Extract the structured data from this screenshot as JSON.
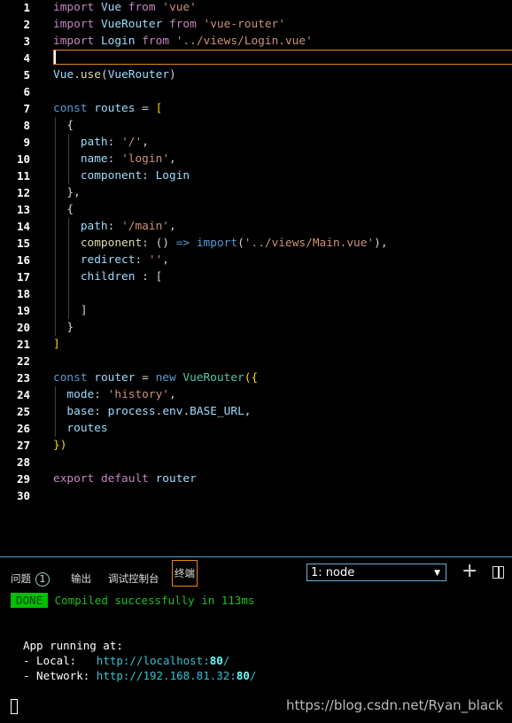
{
  "editor": {
    "lines": [
      [
        [
          "import ",
          "kw"
        ],
        [
          "Vue ",
          "v"
        ],
        [
          "from ",
          "kw"
        ],
        [
          "'vue'",
          "s"
        ]
      ],
      [
        [
          "import ",
          "kw"
        ],
        [
          "VueRouter ",
          "v"
        ],
        [
          "from ",
          "kw"
        ],
        [
          "'vue-router'",
          "s"
        ]
      ],
      [
        [
          "import ",
          "kw"
        ],
        [
          "Login ",
          "v"
        ],
        [
          "from ",
          "kw"
        ],
        [
          "'../views/Login.vue'",
          "s"
        ]
      ],
      [],
      [
        [
          "Vue",
          "v"
        ],
        [
          ".",
          "p"
        ],
        [
          "use",
          "f"
        ],
        [
          "(",
          "p"
        ],
        [
          "VueRouter",
          "v"
        ],
        [
          ")",
          "p"
        ]
      ],
      [],
      [
        [
          "const ",
          "st"
        ],
        [
          "routes ",
          "v"
        ],
        [
          "= ",
          "p"
        ],
        [
          "[",
          "b"
        ]
      ],
      [
        [
          "  {",
          "p"
        ]
      ],
      [
        [
          "    path",
          "v"
        ],
        [
          ": ",
          "p"
        ],
        [
          "'/'",
          "s"
        ],
        [
          ",",
          "p"
        ]
      ],
      [
        [
          "    name",
          "v"
        ],
        [
          ": ",
          "p"
        ],
        [
          "'login'",
          "s"
        ],
        [
          ",",
          "p"
        ]
      ],
      [
        [
          "    component",
          "v"
        ],
        [
          ": ",
          "p"
        ],
        [
          "Login",
          "v"
        ]
      ],
      [
        [
          "  },",
          "p"
        ]
      ],
      [
        [
          "  {",
          "p"
        ]
      ],
      [
        [
          "    path",
          "v"
        ],
        [
          ": ",
          "p"
        ],
        [
          "'/main'",
          "s"
        ],
        [
          ",",
          "p"
        ]
      ],
      [
        [
          "    component",
          "f"
        ],
        [
          ": () ",
          "p"
        ],
        [
          "=> ",
          "st"
        ],
        [
          "import",
          "st"
        ],
        [
          "(",
          "p"
        ],
        [
          "'../views/Main.vue'",
          "s"
        ],
        [
          "),",
          "p"
        ]
      ],
      [
        [
          "    redirect",
          "v"
        ],
        [
          ": ",
          "p"
        ],
        [
          "''",
          "s"
        ],
        [
          ",",
          "p"
        ]
      ],
      [
        [
          "    children ",
          "v"
        ],
        [
          ": [",
          "p"
        ]
      ],
      [],
      [
        [
          "    ]",
          "p"
        ]
      ],
      [
        [
          "  }",
          "p"
        ]
      ],
      [
        [
          "]",
          "b"
        ]
      ],
      [],
      [
        [
          "const ",
          "st"
        ],
        [
          "router ",
          "v"
        ],
        [
          "= ",
          "p"
        ],
        [
          "new ",
          "st"
        ],
        [
          "VueRouter",
          "c"
        ],
        [
          "({",
          "b"
        ]
      ],
      [
        [
          "  mode",
          "v"
        ],
        [
          ": ",
          "p"
        ],
        [
          "'history'",
          "s"
        ],
        [
          ",",
          "p"
        ]
      ],
      [
        [
          "  base",
          "v"
        ],
        [
          ": ",
          "p"
        ],
        [
          "process",
          "v"
        ],
        [
          ".",
          "p"
        ],
        [
          "env",
          "v"
        ],
        [
          ".",
          "p"
        ],
        [
          "BASE_URL",
          "v"
        ],
        [
          ",",
          "p"
        ]
      ],
      [
        [
          "  routes",
          "v"
        ]
      ],
      [
        [
          "})",
          "b"
        ]
      ],
      [],
      [
        [
          "export ",
          "kw"
        ],
        [
          "default ",
          "kw"
        ],
        [
          "router",
          "v"
        ]
      ],
      []
    ]
  },
  "panel": {
    "tabs": [
      {
        "label": "问题",
        "badge": "1"
      },
      {
        "label": "输出"
      },
      {
        "label": "调试控制台"
      },
      {
        "label": "终端",
        "active": true
      }
    ],
    "terminal_select": "1: node",
    "icons": [
      "dropdown-arrow-icon",
      "plus-icon",
      "split-icon"
    ]
  },
  "terminal": {
    "done_badge": "DONE",
    "compiled": "Compiled successfully in 113ms",
    "app_running": "App running at:",
    "local_label": "- Local:   ",
    "local_url_a": "http://localhost:",
    "local_port": "80",
    "local_url_b": "/",
    "network_label": "- Network: ",
    "network_url_a": "http://192.168.81.32:",
    "network_port": "80",
    "network_url_b": "/"
  },
  "watermark": "https://blog.csdn.net/Ryan_black",
  "colors": {
    "accent_border": "#e8841a",
    "done_green": "#00c000",
    "url": "#2fc4d4"
  }
}
